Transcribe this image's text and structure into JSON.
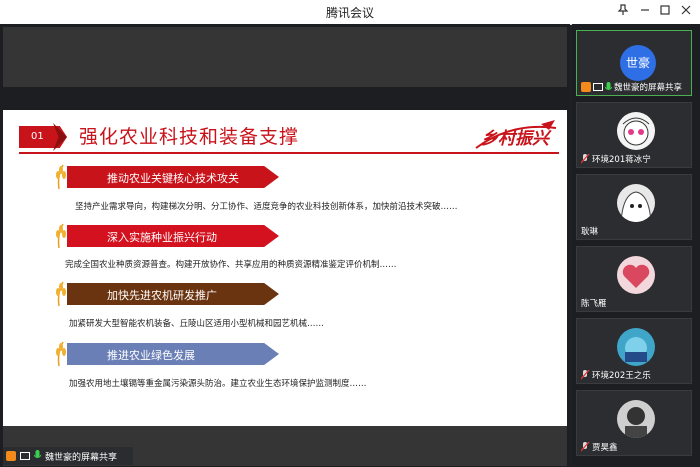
{
  "window": {
    "title": "腾讯会议"
  },
  "slide": {
    "section_number": "01",
    "section_title": "强化农业科技和装备支撑",
    "brand_text": "乡村振兴",
    "items": [
      {
        "title": "推动农业关键核心技术攻关",
        "body": "坚持产业需求导向，构建梯次分明、分工协作、适度竞争的农业科技创新体系，加快前沿技术突破……",
        "color": "#c9131b"
      },
      {
        "title": "深入实施种业振兴行动",
        "body": "完成全国农业种质资源普查。构建开放协作、共享应用的种质资源精准鉴定评价机制……",
        "color": "#d4121f"
      },
      {
        "title": "加快先进农机研发推广",
        "body": "加紧研发大型智能农机装备、丘陵山区适用小型机械和园艺机械……",
        "color": "#6b3410"
      },
      {
        "title": "推进农业绿色发展",
        "body": "加强农用地土壤镉等重金属污染源头防治。建立农业生态环境保护监测制度……",
        "color": "#6a7fb5"
      }
    ]
  },
  "share_bar": {
    "label": "魏世豪的屏幕共享"
  },
  "participants": [
    {
      "name": "魏世豪的屏幕共享",
      "avatar_text": "世豪",
      "sharing": true
    },
    {
      "name": "环境201蒋冰宁"
    },
    {
      "name": "耿琳"
    },
    {
      "name": "陈飞雁"
    },
    {
      "name": "环境202王之乐"
    },
    {
      "name": "贾昊鑫"
    }
  ]
}
